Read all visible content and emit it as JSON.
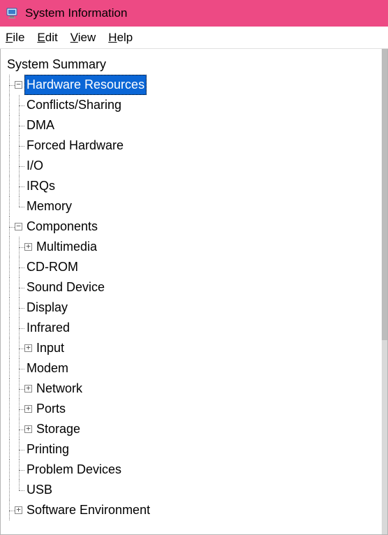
{
  "window": {
    "title": "System Information",
    "icon": "system-info-icon"
  },
  "menu": {
    "file": "File",
    "edit": "Edit",
    "view": "View",
    "help": "Help"
  },
  "tree": {
    "root": "System Summary",
    "hardware_resources": {
      "label": "Hardware Resources",
      "expanded": true,
      "selected": true,
      "children": {
        "conflicts": "Conflicts/Sharing",
        "dma": "DMA",
        "forced": "Forced Hardware",
        "io": "I/O",
        "irqs": "IRQs",
        "memory": "Memory"
      }
    },
    "components": {
      "label": "Components",
      "expanded": true,
      "children": {
        "multimedia": {
          "label": "Multimedia",
          "expandable": true
        },
        "cdrom": "CD-ROM",
        "sound": "Sound Device",
        "display": "Display",
        "infrared": "Infrared",
        "input": {
          "label": "Input",
          "expandable": true
        },
        "modem": "Modem",
        "network": {
          "label": "Network",
          "expandable": true
        },
        "ports": {
          "label": "Ports",
          "expandable": true
        },
        "storage": {
          "label": "Storage",
          "expandable": true
        },
        "printing": "Printing",
        "problem": "Problem Devices",
        "usb": "USB"
      }
    },
    "software_env": {
      "label": "Software Environment",
      "expandable": true
    }
  },
  "glyphs": {
    "plus": "+",
    "minus": "−"
  }
}
